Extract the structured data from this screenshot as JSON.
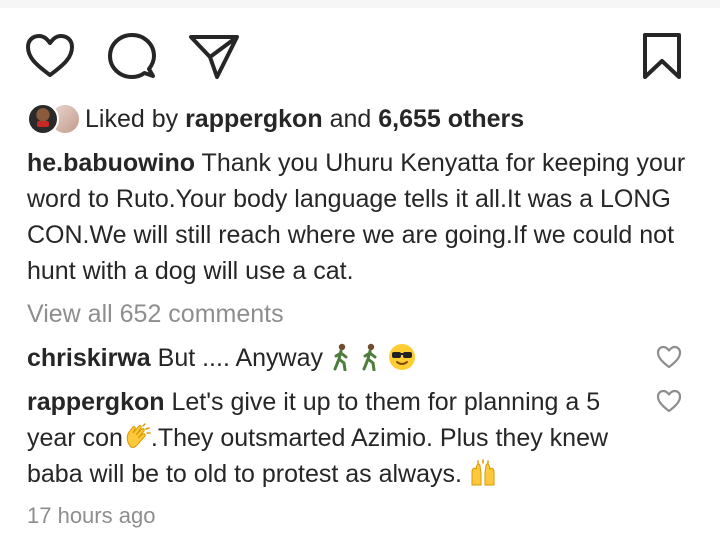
{
  "post": {
    "likes": {
      "prefix": "Liked by",
      "user": "rappergkon",
      "conj": "and",
      "others": "6,655 others"
    },
    "caption": {
      "username": "he.babuowino",
      "text": "Thank you Uhuru Kenyatta for keeping your word to Ruto.Your body language tells it all.It was a LONG CON.We will still reach where we are going.If we could not hunt with a dog will use a cat."
    },
    "view_all_label": "View all 652 comments",
    "comments": [
      {
        "username": "chriskirwa",
        "text_1": "But .... Anyway",
        "text_2": ""
      },
      {
        "username": "rappergkon",
        "text_1": "Let's give it up to them for planning a 5 year con",
        "text_2": ".They outsmarted Azimio. Plus they knew baba will be to old to protest as always."
      }
    ],
    "timestamp": "17 hours ago"
  },
  "icons": {
    "like": "heart-outline-icon",
    "comment": "speech-bubble-icon",
    "share": "paper-plane-icon",
    "save": "bookmark-icon",
    "comment_like": "small-heart-icon",
    "emojis": [
      "walking-person-icon",
      "walking-person-icon",
      "cool-face-icon",
      "clapping-hands-icon",
      "raising-hands-icon"
    ]
  },
  "colors": {
    "text": "#262626",
    "muted": "#8e8e8e",
    "background": "#ffffff"
  }
}
